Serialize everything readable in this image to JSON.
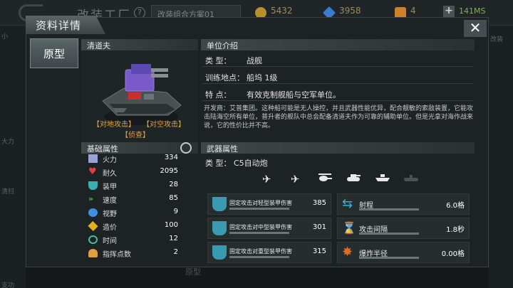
{
  "background": {
    "title": "改装工厂",
    "help": "?",
    "plan": "改装组合方案01",
    "resources": [
      {
        "icon": "gold-coin-icon",
        "value": "5432",
        "color": "#b8902a"
      },
      {
        "icon": "blue-diamond-icon",
        "value": "3958",
        "color": "#3a7ad0"
      },
      {
        "icon": "orange-fuel-icon",
        "value": "4",
        "color": "#d0802a"
      }
    ],
    "plus": "+",
    "timer": "141MS",
    "bottom_label": "原型",
    "left_tabs": [
      "小",
      "大力",
      "清扫",
      "支功"
    ],
    "right_tabs": [
      "改装"
    ]
  },
  "panel": {
    "title": "资料详情",
    "close": "✕",
    "side_tab": "原型",
    "unit_name": "清道夫",
    "tags": [
      "【对地攻击】",
      "【对空攻击】",
      "【侦查】"
    ]
  },
  "base_stats": {
    "header": "基础属性",
    "rows": [
      {
        "icon": "firepower-icon",
        "color": "#9aa3d8",
        "label": "火力",
        "value": "334"
      },
      {
        "icon": "heart-icon",
        "color": "#e04040",
        "label": "耐久",
        "value": "2095"
      },
      {
        "icon": "armor-shield-icon",
        "color": "#3ab0b0",
        "label": "装甲",
        "value": "28"
      },
      {
        "icon": "speed-chevron-icon",
        "color": "#40c040",
        "label": "速度",
        "value": "85"
      },
      {
        "icon": "eye-icon",
        "color": "#4090e0",
        "label": "视野",
        "value": "9"
      },
      {
        "icon": "cost-cube-icon",
        "color": "#e0b020",
        "label": "造价",
        "value": "100"
      },
      {
        "icon": "clock-icon",
        "color": "#40c0a0",
        "label": "时间",
        "value": "12"
      },
      {
        "icon": "command-person-icon",
        "color": "#e0a040",
        "label": "指挥点数",
        "value": "2"
      }
    ]
  },
  "unit_intro": {
    "header": "单位介绍",
    "rows": [
      {
        "key": "类    型：",
        "value": "战舰"
      },
      {
        "key": "训练地点：",
        "value": "船坞 1级"
      },
      {
        "key": "特    点：",
        "value": "有效克制舰船与空军单位。"
      }
    ],
    "description": "开发商：艾普集团。这种船可能是无人操控，并且武器性能优异，配合靓敏的索敌装置，它能攻击陆海空所有单位，普升者的舰队中总会配备清道夫作为可靠的辅助单位。但是光拿对海作战来说，它的性价比并不高。"
  },
  "weapon": {
    "header": "武器属性",
    "type_key": "类    型：",
    "type_value": "C5自动炮",
    "target_icons": [
      {
        "name": "fighter-jet-icon",
        "glyph": "✈",
        "active": true
      },
      {
        "name": "bomber-plane-icon",
        "glyph": "✈",
        "active": true
      },
      {
        "name": "helicopter-icon",
        "glyph": "🚁",
        "active": true
      },
      {
        "name": "tank-icon",
        "glyph": "▬",
        "active": true
      },
      {
        "name": "ship-icon",
        "glyph": "⛴",
        "active": true
      },
      {
        "name": "submarine-icon",
        "glyph": "▬",
        "active": false
      }
    ],
    "damage": [
      {
        "icon": "light-armor-shield-icon",
        "label": "固定攻击对轻型装甲伤害",
        "value": "385"
      },
      {
        "icon": "medium-armor-shield-icon",
        "label": "固定攻击对中型装甲伤害",
        "value": "301"
      },
      {
        "icon": "heavy-armor-shield-icon",
        "label": "固定攻击对重型装甲伤害",
        "value": "315"
      }
    ],
    "props": [
      {
        "icon": "range-arrows-icon",
        "label": "射程",
        "value": "6.0格"
      },
      {
        "icon": "hourglass-icon",
        "label": "攻击间隔",
        "value": "1.8秒"
      },
      {
        "icon": "explosion-icon",
        "label": "爆炸半径",
        "value": "0.00格"
      }
    ]
  }
}
